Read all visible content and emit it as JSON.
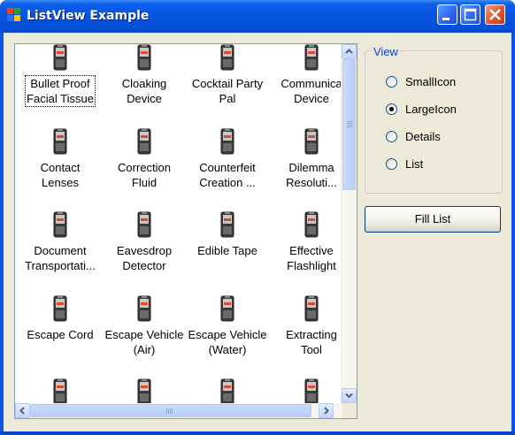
{
  "window": {
    "title": "ListView Example"
  },
  "listview": {
    "items": [
      {
        "label_line1": "Bullet Proof",
        "label_line2": "Facial Tissue",
        "selected": true
      },
      {
        "label_line1": "Cloaking",
        "label_line2": "Device"
      },
      {
        "label_line1": "Cocktail Party",
        "label_line2": "Pal"
      },
      {
        "label_line1": "Communica",
        "label_line2": "Device"
      },
      {
        "label_line1": "Contact",
        "label_line2": "Lenses"
      },
      {
        "label_line1": "Correction",
        "label_line2": "Fluid"
      },
      {
        "label_line1": "Counterfeit",
        "label_line2": "Creation ..."
      },
      {
        "label_line1": "Dilemma",
        "label_line2": "Resoluti..."
      },
      {
        "label_line1": "Document",
        "label_line2": "Transportati..."
      },
      {
        "label_line1": "Eavesdrop",
        "label_line2": "Detector"
      },
      {
        "label_line1": "Edible Tape",
        "label_line2": ""
      },
      {
        "label_line1": "Effective",
        "label_line2": "Flashlight"
      },
      {
        "label_line1": "Escape Cord",
        "label_line2": ""
      },
      {
        "label_line1": "Escape Vehicle",
        "label_line2": "(Air)"
      },
      {
        "label_line1": "Escape Vehicle",
        "label_line2": "(Water)"
      },
      {
        "label_line1": "Extracting",
        "label_line2": "Tool"
      },
      {
        "label_line1": "",
        "label_line2": ""
      },
      {
        "label_line1": "",
        "label_line2": ""
      },
      {
        "label_line1": "",
        "label_line2": ""
      },
      {
        "label_line1": "",
        "label_line2": ""
      }
    ],
    "scroll_up_icon": "arrow-up-icon",
    "scroll_down_icon": "arrow-down-icon",
    "scroll_left_icon": "arrow-left-icon",
    "scroll_right_icon": "arrow-right-icon"
  },
  "view_group": {
    "title": "View",
    "options": [
      {
        "label": "SmallIcon",
        "checked": false
      },
      {
        "label": "LargeIcon",
        "checked": true
      },
      {
        "label": "Details",
        "checked": false
      },
      {
        "label": "List",
        "checked": false
      }
    ]
  },
  "fill_button": {
    "label": "Fill List"
  },
  "colors": {
    "titlebar": "#0654e0",
    "client": "#ece9d8",
    "groupbox_title": "#0046d5"
  }
}
